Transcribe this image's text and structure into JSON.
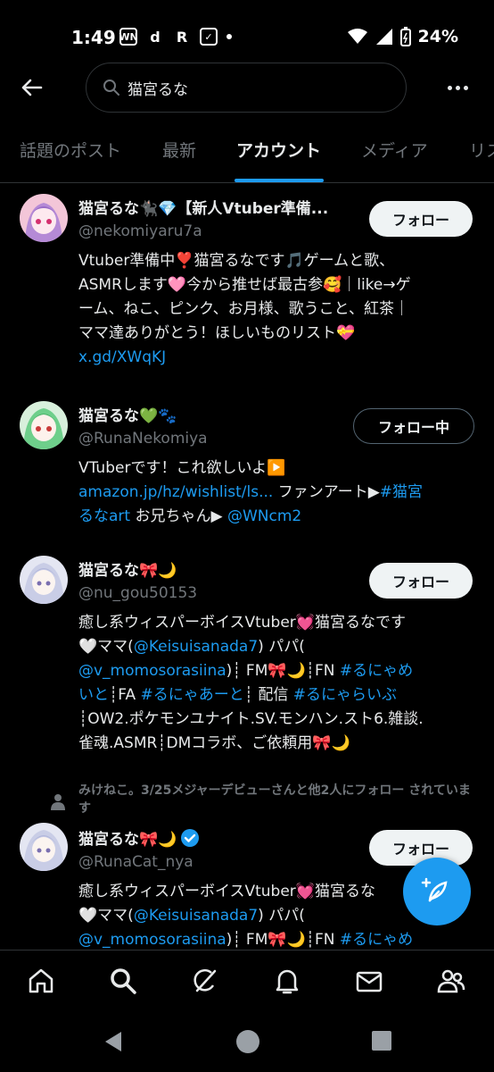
{
  "status_bar": {
    "time": "1:49",
    "battery": "24%",
    "app_icons": [
      "WN",
      "d",
      "R"
    ]
  },
  "search": {
    "query": "猫宮るな"
  },
  "tabs": [
    {
      "label": "話題のポスト",
      "active": false
    },
    {
      "label": "最新",
      "active": false
    },
    {
      "label": "アカウント",
      "active": true
    },
    {
      "label": "メディア",
      "active": false
    },
    {
      "label": "リス",
      "active": false
    }
  ],
  "accounts": [
    {
      "name": "猫宮るな🐈‍⬛💎【新人Vtuber準備...",
      "handle": "@nekomiyaru7a",
      "button": "フォロー",
      "bio_lines": [
        "Vtuber準備中❣️猫宮るなです🎵ゲームと歌、",
        "ASMRします🩷今から推せば最古参🥰｜like→ゲ",
        "ーム、ねこ、ピンク、お月様、歌うこと、紅茶｜",
        "ママ達ありがとう！ほしいものリスト💝"
      ],
      "link": "x.gd/XWqKJ"
    },
    {
      "name": "猫宮るな💚🐾",
      "handle": "@RunaNekomiya",
      "button": "フォロー中",
      "bio_line1": "VTuberです！これ欲しいよ▶️",
      "bio_link1": "amazon.jp/hz/wishlist/ls...",
      "bio_text2": " ファンアート▶",
      "bio_link2": "#猫宮",
      "bio_link3": "るなart",
      "bio_text3": " お兄ちゃん▶ ",
      "bio_link4": "@WNcm2"
    },
    {
      "name": "猫宮るな🎀🌙",
      "handle": "@nu_gou50153",
      "button": "フォロー",
      "l1": "癒し系ウィスパーボイスVtuber💓猫宮るなです",
      "l2a": "🤍ママ(",
      "l2b": "@Keisuisanada7",
      "l2c": ") パパ(",
      "l3a": "@v_momosorasiina",
      "l3b": ")┊ FM🎀🌙┊FN ",
      "l3c": "#るにゃめ",
      "l4a": "いと",
      "l4b": "┊FA ",
      "l4c": "#るにゃあーと",
      "l4d": "┊ 配信 ",
      "l4e": "#るにゃらいぶ",
      "l5": "┊OW2.ポケモンユナイト.SV.モンハン.スト6.雑談.",
      "l6": "雀魂.ASMR┊DMコラボ、ご依頼用🎀🌙"
    },
    {
      "social_context": "みけねこ。3/25メジャーデビューさんと他2人にフォロー されています",
      "name": "猫宮るな🎀🌙",
      "handle": "@RunaCat_nya",
      "button": "フォロー",
      "l1": "癒し系ウィスパーボイスVtuber💓猫宮るな",
      "l2a": "🤍ママ(",
      "l2b": "@Keisuisanada7",
      "l2c": ") パパ(",
      "l3a": "@v_momosorasiina",
      "l3b": ")┊ FM🎀🌙┊FN ",
      "l3c": "#るにゃめ"
    }
  ],
  "colors": {
    "background": "#000000",
    "accent": "#1d9bf0",
    "text": "#e7e9ea",
    "secondary": "#71767b"
  }
}
